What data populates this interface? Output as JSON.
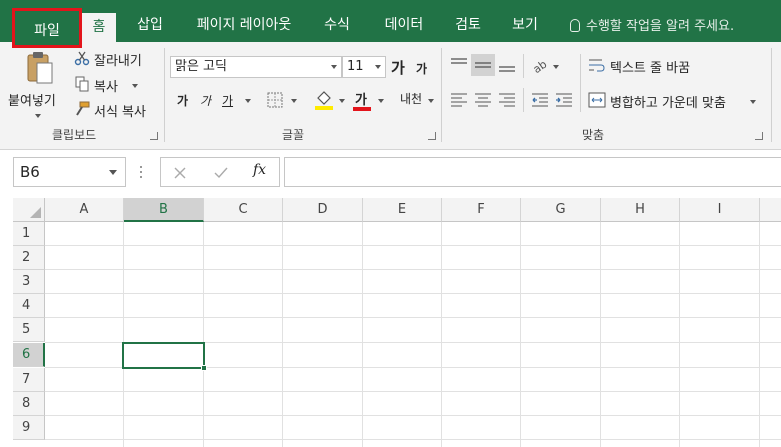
{
  "tabs": [
    {
      "label": "파일"
    },
    {
      "label": "홈"
    },
    {
      "label": "삽입"
    },
    {
      "label": "페이지 레이아웃"
    },
    {
      "label": "수식"
    },
    {
      "label": "데이터"
    },
    {
      "label": "검토"
    },
    {
      "label": "보기"
    }
  ],
  "tell_me": "수행할 작업을 알려 주세요.",
  "clipboard": {
    "paste": "붙여넣기",
    "cut": "잘라내기",
    "copy": "복사",
    "format_painter": "서식 복사",
    "group": "클립보드"
  },
  "font": {
    "name": "맑은 고딕",
    "size": "11",
    "grow": "가",
    "shrink": "가",
    "bold": "가",
    "italic": "가",
    "underline": "가",
    "font_color": "가",
    "phonetic": "내천",
    "group": "글꼴"
  },
  "alignment": {
    "wrap_text": "텍스트 줄 바꿈",
    "merge_center": "병합하고 가운데 맞춤",
    "group": "맞춤"
  },
  "formula_bar": {
    "name_box": "B6",
    "fx": "fx",
    "value": ""
  },
  "grid": {
    "columns": [
      "A",
      "B",
      "C",
      "D",
      "E",
      "F",
      "G",
      "H",
      "I"
    ],
    "rows": [
      "1",
      "2",
      "3",
      "4",
      "5",
      "6",
      "7",
      "8",
      "9"
    ],
    "selected_cell": "B6"
  },
  "colors": {
    "accent": "#217346",
    "highlight_box": "#e3141b"
  }
}
